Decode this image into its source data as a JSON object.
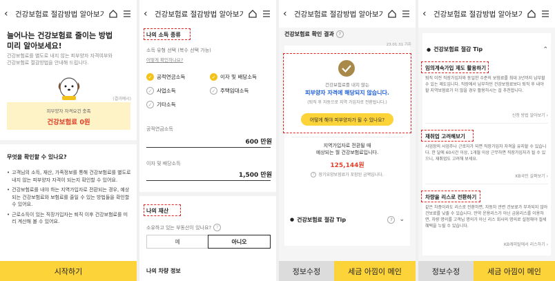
{
  "header": {
    "title": "건강보험료 절감방법 알아보기"
  },
  "s1": {
    "headline1": "늘어나는 건강보험료 줄이는 방법",
    "headline2": "미리 알아보세요!",
    "desc1": "건강보험료를 별도로 내지 않는 피부양자 자격여부와",
    "desc2": "건강보험료 절감방법을 안내해 드립니다.",
    "example_note": "(결과예시)",
    "card_caption": "피부양자 자격요건 충족",
    "card_result": "건강보험료 0원",
    "what_title": "무엇을 확인할 수 있나요?",
    "bullets": [
      "고객님의 소득, 재산, 가족정보를 통해 건강보험료를 별도로 내지 않는 피부양자 자격이 되는지 확인할 수 있어요.",
      "건강보험료를 내야 하는 지역가입자로 전환되는 경우, 예상되는 건강보험료와 보험료를 줄일 수 있는 방법들을 확인할 수 있어요.",
      "근로소득이 있는 직장가입자는 퇴직 이후 건강보험료를 미리 계산해 볼 수 있어요."
    ],
    "start_button": "시작하기"
  },
  "s2": {
    "section_income": "나의 소득 종류",
    "income_prompt": "소득 유형 선택 (복수 선택 가능)",
    "income_help": "어떻게 확인하나요?",
    "options": [
      {
        "label": "공적연금소득",
        "checked": true
      },
      {
        "label": "이자 및 배당소득",
        "checked": true
      },
      {
        "label": "사업소득",
        "checked": false
      },
      {
        "label": "주택임대소득",
        "checked": false
      },
      {
        "label": "기타소득",
        "checked": false
      }
    ],
    "pension_label": "공적연금소득",
    "pension_value": "600 만원",
    "interest_label": "이자 및 배당소득",
    "interest_value": "1,500 만원",
    "section_asset": "나의 재산",
    "realestate_q": "소유하고 있는 부동산이 있나요?",
    "yes": "예",
    "no": "아니오",
    "vehicle_title": "나의 차량 정보"
  },
  "s3": {
    "result_title": "건강보험료 확인 결과",
    "date": "23.01.31 기준",
    "result_line1": "건강보험료를 내지 않는",
    "result_line2": "피부양자 자격에 해당되지 않습니다.",
    "result_line3": "(퇴직 후 자동으로 지역 가입자로 전환됩니다.)",
    "how_button": "어떻게 해야 피부양자가 될 수 있나요?",
    "regional1": "지역가입자로 전환될 때",
    "regional2": "예상되는 월 건강보험료입니다.",
    "amount": "125,144원",
    "ltc_note": "장기요양보험료가 포함된 금액입니다.",
    "tip_title": "건강보험료 절감 Tip",
    "edit_button": "정보수정",
    "tax_button": "세금 아낌이 메인"
  },
  "s4": {
    "tip_title": "건강보험료 절감 Tip",
    "tips": [
      {
        "title": "임의계속가입 제도 활용하기",
        "body": "퇴직 이전 직장가입자와 동일한 수준의 보험료를 최대 3년까지 납부할 수 있는 제도입니다. 직장에서 납부하던 건강보험료보다 퇴직 후 내야 할 지역보험료가 더 많을 경우 활용하시는 걸 추천합니다.",
        "link": "신청 방법 알아보기"
      },
      {
        "title": "재취업 고려해보기",
        "body": "사업장의 사업주나 근로자가 되면 직장가입자 자격을 유지할 수 있습니다. 한 달에 60시간 이상, 1개월 이상 근무하면 직장가입자가 될 수 있으니, 재취업도 고려해 보세요.",
        "link": "KB국민 살펴보기"
      },
      {
        "title": "차량을 리스로 전환하기",
        "body": "같은 차종이라도 리스로 전환하면, 자동차 관련 건보료가 부과되지 않아 건보료를 낮출 수 있습니다. 만약 운용리스가 아닌 금융리스를 이용하면, 차량 명의를 고객님 명의가 아닌 리스 회사의 명의로 설정해야 절세 혜택을 누릴 수 있습니다.",
        "link": "KB캐피탈에서 리스하기"
      }
    ],
    "edit_button": "정보수정",
    "tax_button": "세금 아낌이 메인"
  }
}
